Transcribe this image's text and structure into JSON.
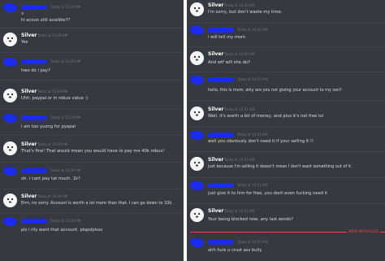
{
  "left_panel": {
    "messages": [
      {
        "author": "",
        "time": "Today at 10:28 AM",
        "avatar": "redacted",
        "lines": [
          "v",
          "hi acoun still avalible??"
        ]
      },
      {
        "author": "Silver",
        "time": "Today at 10:28 AM",
        "avatar": "silver",
        "lines": [
          "Yes"
        ]
      },
      {
        "author": "",
        "time": "Today at 10:29 AM",
        "avatar": "redacted",
        "lines": [
          "hwo do i pay?"
        ]
      },
      {
        "author": "Silver",
        "time": "Today at 10:29 AM",
        "avatar": "silver",
        "lines": [
          "Uhh, paypal or in robux value :)"
        ]
      },
      {
        "author": "",
        "time": "Today at 10:29 AM",
        "avatar": "redacted",
        "lines": [
          "i am too yuong for pyapal"
        ]
      },
      {
        "author": "Silver",
        "time": "Today at 10:29 AM",
        "avatar": "silver",
        "lines": [
          "That's fine! That would mean you would have to pay me 40k robux!"
        ]
      },
      {
        "author": "",
        "time": "Today at 10:30 AM",
        "avatar": "redacted",
        "lines": [
          "oh. i cant pay tat much. 1k?"
        ]
      },
      {
        "author": "Silver",
        "time": "Today at 10:30 AM",
        "avatar": "silver",
        "lines": [
          "Erm, no sorry. Account is worth a lot more than that. I can go down to 32k."
        ]
      },
      {
        "author": "",
        "time": "Today at 10:30 AM",
        "avatar": "redacted",
        "lines": [
          "pls i rlly want that account. plspslplsss"
        ]
      }
    ]
  },
  "right_panel": {
    "messages": [
      {
        "author": "Silver",
        "time": "Today at 10:30 AM",
        "avatar": "silver",
        "lines": [
          "I'm sorry, but don't waste my time."
        ]
      },
      {
        "author": "",
        "time": "Today at 10:30 AM",
        "avatar": "redacted",
        "lines": [
          "i will tell my mom"
        ]
      },
      {
        "author": "Silver",
        "time": "Today at 10:30 AM",
        "avatar": "silver",
        "lines": [
          "And wtf will she do?"
        ]
      },
      {
        "author": "",
        "time": "Today at 10:31 AM",
        "avatar": "redacted",
        "lines": [
          "hello, this is mom, why are you not giving your account to my son?"
        ]
      },
      {
        "author": "Silver",
        "time": "Today at 10:31 AM",
        "avatar": "silver",
        "lines": [
          "Well, it's worth a bit of money, and plus it's not free lol"
        ]
      },
      {
        "author": "",
        "time": "Today at 10:31 AM",
        "avatar": "redacted",
        "lines": [
          "well you obviously don't need it if your selling it !!"
        ]
      },
      {
        "author": "Silver",
        "time": "Today at 10:31 AM",
        "avatar": "silver",
        "lines": [
          "Just because I'm selling it doesn't mean I don't want something out of it."
        ]
      },
      {
        "author": "",
        "time": "Today at 10:31 AM",
        "avatar": "redacted",
        "lines": [
          "just give it to him for free, you dont even fucking need it"
        ]
      },
      {
        "author": "Silver",
        "time": "Today at 10:31 AM",
        "avatar": "silver",
        "lines": [
          "Your being blocked now, any last words?"
        ]
      },
      {
        "author": "",
        "time": "Today at 10:31 AM",
        "avatar": "redacted",
        "lines": [
          "ahh fuck u crust ass bully"
        ]
      }
    ],
    "new_messages_label": "NEW MESSAGES"
  },
  "colors": {
    "background": "#36393f",
    "text": "#dcddde",
    "timestamp": "#72767d",
    "redaction": "#1b2cf0",
    "new_messages": "#f04747"
  }
}
